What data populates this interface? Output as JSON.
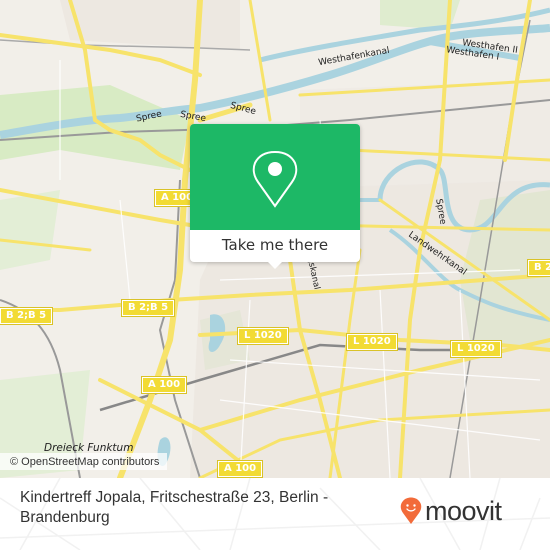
{
  "map": {
    "place_labels": {
      "westhafen_2": "Westhafen II",
      "westhafen_1": "Westhafen I",
      "westhafenkanal": "Westhafenkanal",
      "charlottenburger_verbindungskanal": "Charlottenburger Verbindungskanal",
      "spree_1": "Spree",
      "spree_2": "Spree",
      "spree_3": "Spree",
      "spree_4": "Spree",
      "landwehrkanal": "Landwehrkanal",
      "dreieck_funktum": "Dreieck Funktum"
    },
    "road_shields": {
      "a100_top": "A 100",
      "a100_mid": "A 100",
      "a100_bottom": "A 100",
      "b2b5_left": "B 2;B 5",
      "b2b5_center": "B 2;B 5",
      "b2_right": "B 2",
      "l1020_1": "L 1020",
      "l1020_2": "L 1020",
      "l1020_3": "L 1020"
    },
    "attribution": "© OpenStreetMap contributors"
  },
  "popup": {
    "icon": "location-pin-icon",
    "button_label": "Take me there",
    "accent_color": "#1db866"
  },
  "footer": {
    "address": "Kindertreff Jopala, Fritschestraße 23, Berlin - Brandenburg",
    "logo_text": "moovit",
    "logo_color": "#f26b3a"
  }
}
